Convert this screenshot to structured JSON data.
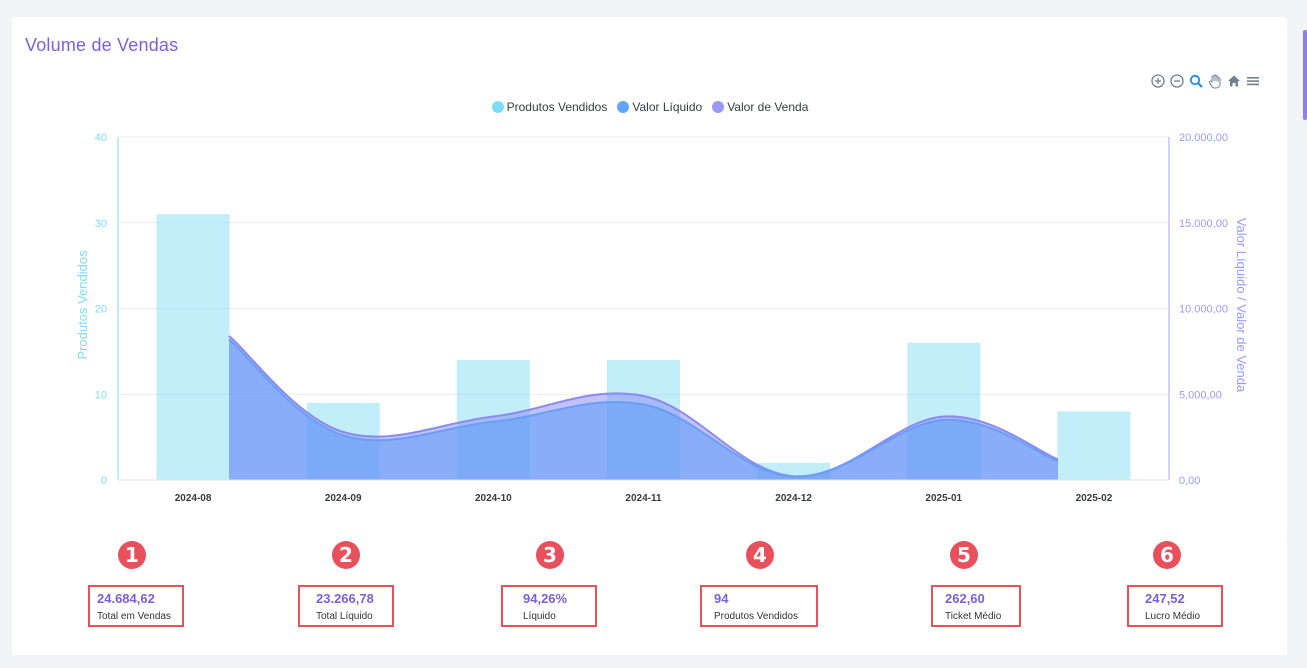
{
  "title": "Volume de Vendas",
  "toolbar": {
    "icons": [
      "zoom-in-icon",
      "zoom-out-icon",
      "selection-zoom-icon",
      "pan-icon",
      "home-icon",
      "menu-icon"
    ]
  },
  "legend": [
    {
      "label": "Produtos Vendidos",
      "color": "#7fdcf5"
    },
    {
      "label": "Valor Líquido",
      "color": "#60a5fa"
    },
    {
      "label": "Valor de Venda",
      "color": "#9b9bf7"
    }
  ],
  "chart_data": {
    "type": "bar",
    "categories": [
      "2024-08",
      "2024-09",
      "2024-10",
      "2024-11",
      "2024-12",
      "2025-01",
      "2025-02"
    ],
    "series": [
      {
        "name": "Produtos Vendidos",
        "type": "bar",
        "axis": "left",
        "values": [
          31,
          9,
          14,
          14,
          2,
          16,
          8
        ]
      },
      {
        "name": "Valor Líquido",
        "type": "area",
        "axis": "right",
        "values": [
          8200,
          2600,
          3400,
          4400,
          200,
          3500,
          1100
        ]
      },
      {
        "name": "Valor de Venda",
        "type": "area",
        "axis": "right",
        "values": [
          8400,
          2800,
          3700,
          4900,
          220,
          3700,
          1200
        ]
      }
    ],
    "ylabel_left": "Produtos Vendidos",
    "ylabel_right": "Valor Líquido / Valor de Venda",
    "ylim_left": [
      0,
      40
    ],
    "ylim_right": [
      0,
      20000
    ],
    "yticks_left": [
      "0",
      "10",
      "20",
      "30",
      "40"
    ],
    "yticks_right": [
      "0,00",
      "5.000,00",
      "10.000,00",
      "15.000,00",
      "20.000,00"
    ],
    "grid": true,
    "legend_position": "top-center"
  },
  "stats": [
    {
      "number": "1",
      "value": "24.684,62",
      "label": "Total em Vendas"
    },
    {
      "number": "2",
      "value": "23.266,78",
      "label": "Total Líquido"
    },
    {
      "number": "3",
      "value": "94,26%",
      "label": "Líquido"
    },
    {
      "number": "4",
      "value": "94",
      "label": "Produtos Vendidos"
    },
    {
      "number": "5",
      "value": "262,60",
      "label": "Ticket Médio"
    },
    {
      "number": "6",
      "value": "247,52",
      "label": "Lucro Médio"
    }
  ]
}
